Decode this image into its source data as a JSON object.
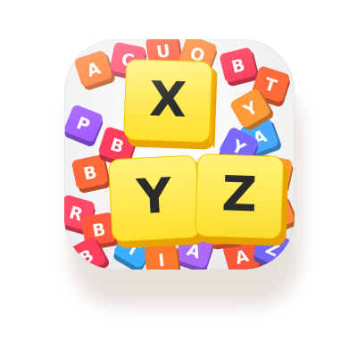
{
  "app_icon": {
    "label": "XYZ letter tile word game",
    "hero_tiles": [
      "X",
      "Y",
      "Z"
    ],
    "background_tiles": [
      {
        "letter": "A",
        "color": "#ff7a2e"
      },
      {
        "letter": "C",
        "color": "#ff4a6a"
      },
      {
        "letter": "U",
        "color": "#ff5a3c"
      },
      {
        "letter": "O",
        "color": "#ff8a3a"
      },
      {
        "letter": "B",
        "color": "#ff3e5e"
      },
      {
        "letter": "T",
        "color": "#ff6a3a"
      },
      {
        "letter": "P",
        "color": "#a15cff"
      },
      {
        "letter": "A",
        "color": "#4aa8ff"
      },
      {
        "letter": "T",
        "color": "#ff9a3a"
      },
      {
        "letter": "Y",
        "color": "#7a6aff"
      },
      {
        "letter": "B",
        "color": "#ff6a3a"
      },
      {
        "letter": "Z",
        "color": "#ff8a3a"
      },
      {
        "letter": "R",
        "color": "#ff4a6a"
      },
      {
        "letter": "B",
        "color": "#ff5a3c"
      },
      {
        "letter": "A",
        "color": "#b06cff"
      },
      {
        "letter": "B",
        "color": "#ff3e5e"
      },
      {
        "letter": "T",
        "color": "#3ab0ff"
      },
      {
        "letter": "I",
        "color": "#ff7a2e"
      },
      {
        "letter": "A",
        "color": "#ff5a3c"
      },
      {
        "letter": "Z",
        "color": "#7a6aff"
      },
      {
        "letter": "A",
        "color": "#ff6a3a"
      },
      {
        "letter": "B",
        "color": "#ff3e5e"
      },
      {
        "letter": "Y",
        "color": "#ff9a3a"
      }
    ],
    "hero_color": "#ffd21a"
  }
}
